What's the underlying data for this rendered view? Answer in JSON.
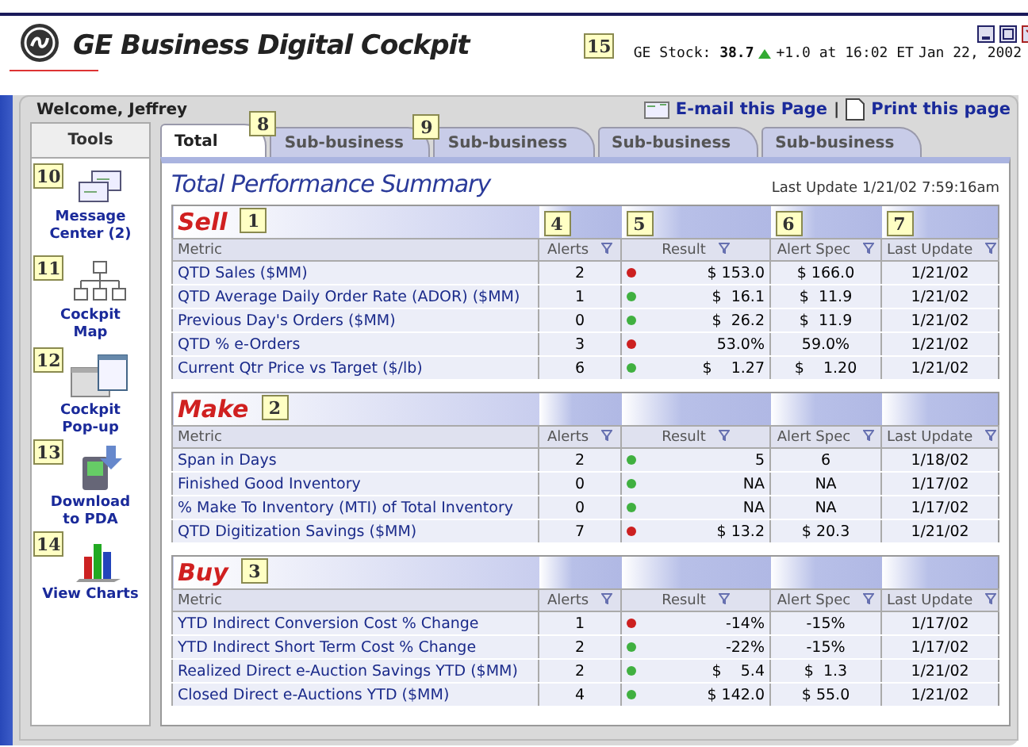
{
  "header": {
    "title": "GE Business Digital Cockpit",
    "callout": "15",
    "stock": "GE Stock: **38.7**",
    "change": "+1.0 at 16:02 ET",
    "date": "Jan 22, 2002"
  },
  "welcome": "Welcome, Jeffrey",
  "links": [
    {
      "label": "E-mail this Page",
      "kind": "email"
    },
    {
      "label": "Print this page",
      "kind": "print"
    }
  ],
  "link_separator": "|",
  "tools": {
    "title": "Tools",
    "items": [
      {
        "kind": "message",
        "callout": "10",
        "label_lines": [
          "Message",
          "Center (2)"
        ]
      },
      {
        "kind": "map",
        "callout": "11",
        "label_lines": [
          "Cockpit",
          "Map"
        ]
      },
      {
        "kind": "popup",
        "callout": "12",
        "label_lines": [
          "Cockpit",
          "Pop-up"
        ]
      },
      {
        "kind": "download",
        "callout": "13",
        "label_lines": [
          "Download",
          "to PDA"
        ]
      },
      {
        "kind": "charts",
        "callout": "14",
        "label_lines": [
          "View Charts"
        ]
      }
    ]
  },
  "tabs": [
    {
      "label": "Total",
      "selected": true,
      "callout": "8"
    },
    {
      "label": "Sub-business",
      "selected": false,
      "callout": "9"
    },
    {
      "label": "Sub-business",
      "selected": false
    },
    {
      "label": "Sub-business",
      "selected": false
    },
    {
      "label": "Sub-business",
      "selected": false
    }
  ],
  "summary": {
    "title": "Total Performance Summary",
    "last_update": "Last Update 1/21/02 7:59:16am"
  },
  "sections": [
    {
      "name": "Sell",
      "callout": "1",
      "columns": [
        {
          "label": "Metric"
        },
        {
          "label": "Alerts",
          "callout": "4"
        },
        {
          "label": "Result",
          "callout": "5"
        },
        {
          "label": "Alert Spec",
          "callout": "6"
        },
        {
          "label": "Last Update",
          "callout": "7"
        }
      ],
      "rows": [
        {
          "metric": "QTD Sales ($MM)",
          "alerts": "2",
          "color": "#cc2020",
          "result": "$ 153.0",
          "spec": "$ 166.0",
          "updated": "1/21/02"
        },
        {
          "metric": "QTD Average Daily Order Rate (ADOR) ($MM)",
          "alerts": "1",
          "color": "#40b040",
          "result": "$  16.1",
          "spec": "$  11.9",
          "updated": "1/21/02"
        },
        {
          "metric": "Previous Day's Orders ($MM)",
          "alerts": "0",
          "color": "#40b040",
          "result": "$  26.2",
          "spec": "$  11.9",
          "updated": "1/21/02"
        },
        {
          "metric": "QTD % e-Orders",
          "alerts": "3",
          "color": "#cc2020",
          "result": "53.0%",
          "spec": "59.0%",
          "updated": "1/21/02"
        },
        {
          "metric": "Current Qtr Price vs Target ($/lb)",
          "alerts": "6",
          "color": "#40b040",
          "result": "$    1.27",
          "spec": "$    1.20",
          "updated": "1/21/02"
        }
      ]
    },
    {
      "name": "Make",
      "callout": "2",
      "columns": [
        {
          "label": "Metric"
        },
        {
          "label": "Alerts"
        },
        {
          "label": "Result"
        },
        {
          "label": "Alert Spec"
        },
        {
          "label": "Last Update"
        }
      ],
      "rows": [
        {
          "metric": "Span in Days",
          "alerts": "2",
          "color": "#40b040",
          "result": "5",
          "spec": "6",
          "updated": "1/18/02"
        },
        {
          "metric": "Finished Good Inventory",
          "alerts": "0",
          "color": "#40b040",
          "result": "NA",
          "spec": "NA",
          "updated": "1/17/02"
        },
        {
          "metric": "% Make To Inventory (MTI) of Total Inventory",
          "alerts": "0",
          "color": "#40b040",
          "result": "NA",
          "spec": "NA",
          "updated": "1/17/02"
        },
        {
          "metric": "QTD Digitization Savings ($MM)",
          "alerts": "7",
          "color": "#cc2020",
          "result": "$ 13.2",
          "spec": "$ 20.3",
          "updated": "1/21/02"
        }
      ]
    },
    {
      "name": "Buy",
      "callout": "3",
      "columns": [
        {
          "label": "Metric"
        },
        {
          "label": "Alerts"
        },
        {
          "label": "Result"
        },
        {
          "label": "Alert Spec"
        },
        {
          "label": "Last Update"
        }
      ],
      "rows": [
        {
          "metric": "YTD Indirect Conversion Cost % Change",
          "alerts": "1",
          "color": "#cc2020",
          "result": "-14%",
          "spec": "-15%",
          "updated": "1/17/02"
        },
        {
          "metric": "YTD Indirect Short Term Cost % Change",
          "alerts": "2",
          "color": "#40b040",
          "result": "-22%",
          "spec": "-15%",
          "updated": "1/17/02"
        },
        {
          "metric": "Realized Direct e-Auction Savings YTD ($MM)",
          "alerts": "2",
          "color": "#40b040",
          "result": "$    5.4",
          "spec": "$  1.3",
          "updated": "1/21/02"
        },
        {
          "metric": "Closed Direct e-Auctions YTD ($MM)",
          "alerts": "4",
          "color": "#40b040",
          "result": "$ 142.0",
          "spec": "$ 55.0",
          "updated": "1/21/02"
        }
      ]
    }
  ]
}
